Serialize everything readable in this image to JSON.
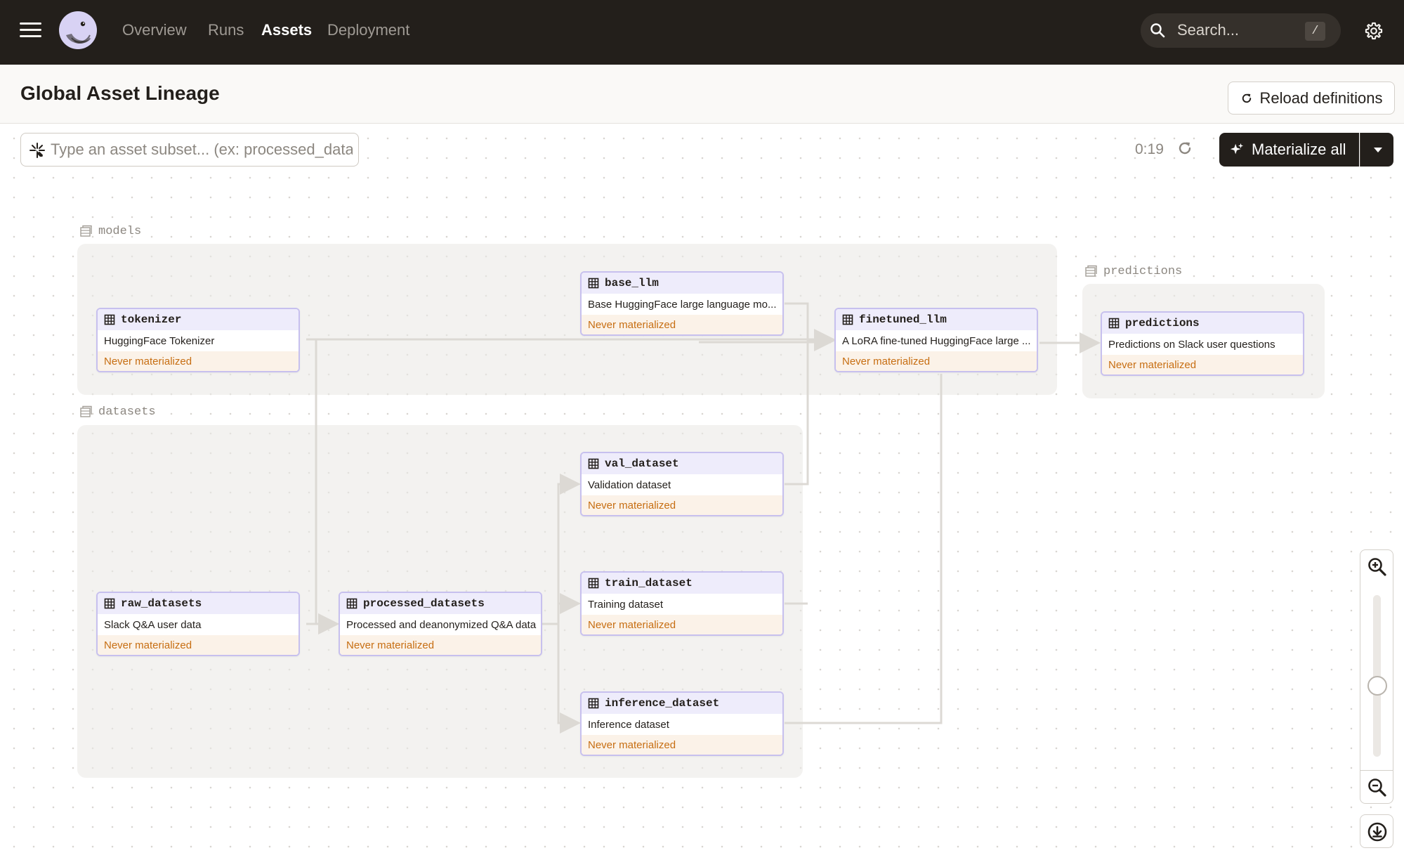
{
  "nav": {
    "items": [
      {
        "label": "Overview",
        "active": false
      },
      {
        "label": "Runs",
        "active": false
      },
      {
        "label": "Assets",
        "active": true
      },
      {
        "label": "Deployment",
        "active": false
      }
    ],
    "search_placeholder": "Search...",
    "search_shortcut": "/"
  },
  "header": {
    "title": "Global Asset Lineage",
    "reload_label": "Reload definitions"
  },
  "toolbar": {
    "subset_placeholder": "Type an asset subset... (ex: processed_datasets+)",
    "timer": "0:19",
    "materialize_label": "Materialize all"
  },
  "groups": [
    {
      "name": "models"
    },
    {
      "name": "datasets"
    },
    {
      "name": "predictions"
    }
  ],
  "assets": {
    "tokenizer": {
      "name": "tokenizer",
      "description": "HuggingFace Tokenizer",
      "status": "Never materialized"
    },
    "base_llm": {
      "name": "base_llm",
      "description": "Base HuggingFace large language mo...",
      "status": "Never materialized"
    },
    "finetuned_llm": {
      "name": "finetuned_llm",
      "description": "A LoRA fine-tuned HuggingFace large ...",
      "status": "Never materialized"
    },
    "predictions": {
      "name": "predictions",
      "description": "Predictions on Slack user questions",
      "status": "Never materialized"
    },
    "val_dataset": {
      "name": "val_dataset",
      "description": "Validation dataset",
      "status": "Never materialized"
    },
    "train_dataset": {
      "name": "train_dataset",
      "description": "Training dataset",
      "status": "Never materialized"
    },
    "raw_datasets": {
      "name": "raw_datasets",
      "description": "Slack Q&A user data",
      "status": "Never materialized"
    },
    "processed_datasets": {
      "name": "processed_datasets",
      "description": "Processed and deanonymized Q&A data",
      "status": "Never materialized"
    },
    "inference_dataset": {
      "name": "inference_dataset",
      "description": "Inference dataset",
      "status": "Never materialized"
    }
  },
  "zoom": {
    "level": 0.43
  },
  "colors": {
    "nav_bg": "#231f1b",
    "node_border": "#c7c0ee",
    "node_header": "#eeecfb",
    "status_text": "#c76e12",
    "status_bg": "#fbf2e8",
    "edge": "#dcd9d4"
  },
  "icons": [
    "menu-icon",
    "dagster-logo-icon",
    "search-icon",
    "gear-icon",
    "refresh-icon",
    "asset-selection-icon",
    "sparkle-icon",
    "caret-down-icon",
    "table-icon",
    "folder-group-icon",
    "zoom-in-icon",
    "zoom-out-icon",
    "download-icon"
  ]
}
